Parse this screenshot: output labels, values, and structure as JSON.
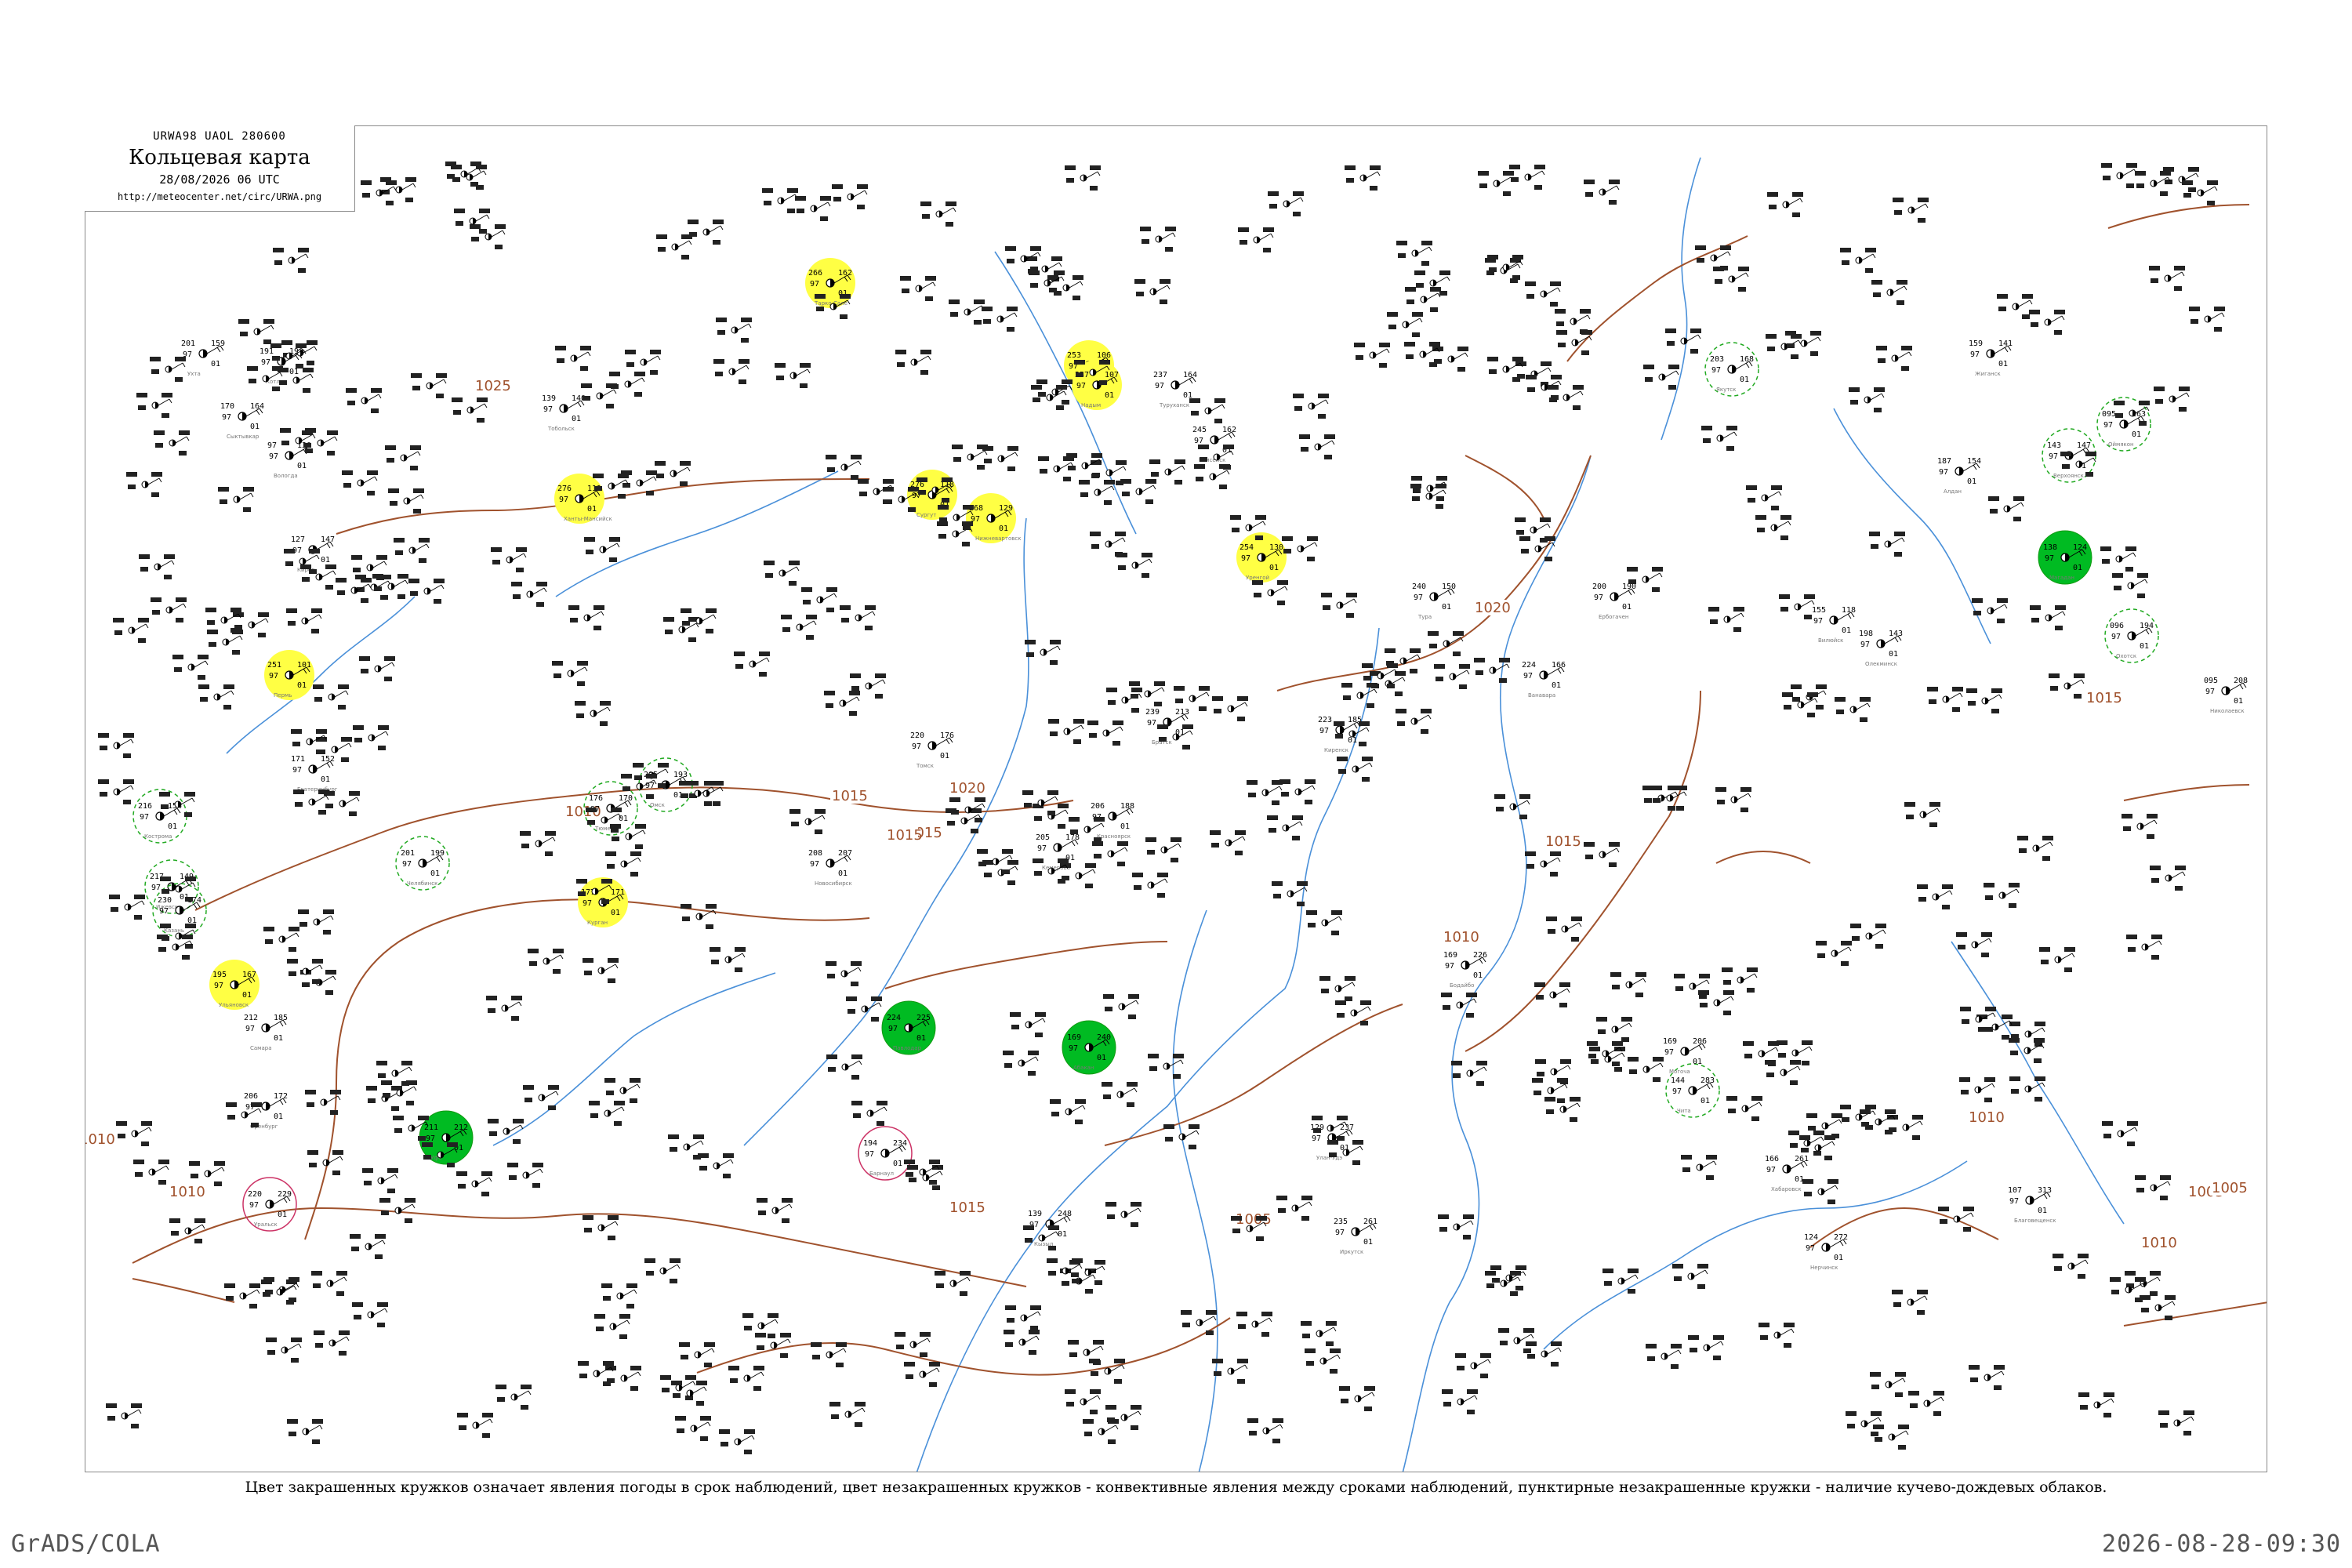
{
  "title_box": {
    "code": "URWA98  UAOL  280600",
    "title": "Кольцевая карта",
    "date": "28/08/2026 06 UTC",
    "url": "http://meteocenter.net/circ/URWA.png"
  },
  "caption": "Цвет закрашенных кружков означает явления погоды в срок наблюдений, цвет незакрашенных кружков - конвективные явления между сроками наблюдений, пунктирные незакрашенные кружки - наличие кучево-дождевых облаков.",
  "footer": {
    "left": "GrADS/COLA",
    "right": "2026-08-28-09:30"
  },
  "colors": {
    "isobar": "#a0522d",
    "river": "#4a90d9",
    "green_fill": "#00bb22",
    "yellow_fill": "#ffff44",
    "red_fill": "#ee2255",
    "green_dashed": "#22aa22",
    "red_ring": "#cc3366"
  },
  "isobar_labels": [
    "1010",
    "1015",
    "1020",
    "1025",
    "1015",
    "1015",
    "1020",
    "1015",
    "1010",
    "1015",
    "1005",
    "1010",
    "1005",
    "1010",
    "1005",
    "1010",
    "1015",
    "1010",
    "1005"
  ],
  "stations": [
    {
      "name": "Ухта",
      "p": "159",
      "t": "201",
      "fill": "none"
    },
    {
      "name": "Сыктывкар",
      "p": "164",
      "t": "170",
      "fill": "none"
    },
    {
      "name": "Котлас",
      "p": "190",
      "t": "191",
      "fill": "none"
    },
    {
      "name": "Вологда",
      "p": "130",
      "t": "97",
      "fill": "none"
    },
    {
      "name": "Киров",
      "p": "147",
      "t": "127",
      "fill": "none"
    },
    {
      "name": "Кострома",
      "p": "154",
      "t": "216",
      "fill": "dashed-green"
    },
    {
      "name": "Ижевск",
      "p": "149",
      "t": "217",
      "fill": "dashed-green"
    },
    {
      "name": "Казань",
      "p": "174",
      "t": "230",
      "fill": "dashed-green"
    },
    {
      "name": "Ульяновск",
      "p": "167",
      "t": "195",
      "fill": "yellow"
    },
    {
      "name": "Самара",
      "p": "185",
      "t": "212",
      "fill": "none"
    },
    {
      "name": "Оренбург",
      "p": "172",
      "t": "206",
      "fill": "none"
    },
    {
      "name": "Уральск",
      "p": "229",
      "t": "220",
      "fill": "red-ring"
    },
    {
      "name": "Пермь",
      "p": "101",
      "t": "251",
      "fill": "yellow"
    },
    {
      "name": "Екатеринбург",
      "p": "152",
      "t": "171",
      "fill": "none"
    },
    {
      "name": "Уфа",
      "p": "212",
      "t": "211",
      "fill": "green"
    },
    {
      "name": "Челябинск",
      "p": "199",
      "t": "201",
      "fill": "dashed-green"
    },
    {
      "name": "Курган",
      "p": "171",
      "t": "177",
      "fill": "yellow"
    },
    {
      "name": "Тюмень",
      "p": "170",
      "t": "176",
      "fill": "dashed-green"
    },
    {
      "name": "Тобольск",
      "p": "140",
      "t": "139",
      "fill": "none"
    },
    {
      "name": "Ханты-Мансийск",
      "p": "111",
      "t": "276",
      "fill": "yellow"
    },
    {
      "name": "Сургут",
      "p": "118",
      "t": "276",
      "fill": "yellow"
    },
    {
      "name": "Нижневартовск",
      "p": "129",
      "t": "268",
      "fill": "yellow"
    },
    {
      "name": "Омск",
      "p": "193",
      "t": "205",
      "fill": "dashed-green"
    },
    {
      "name": "Павлодар",
      "p": "225",
      "t": "224",
      "fill": "green"
    },
    {
      "name": "Новосибирск",
      "p": "207",
      "t": "208",
      "fill": "none"
    },
    {
      "name": "Барнаул",
      "p": "234",
      "t": "194",
      "fill": "red-ring"
    },
    {
      "name": "Кемерово",
      "p": "178",
      "t": "205",
      "fill": "none"
    },
    {
      "name": "Томск",
      "p": "176",
      "t": "220",
      "fill": "none"
    },
    {
      "name": "Красноярск",
      "p": "188",
      "t": "206",
      "fill": "none"
    },
    {
      "name": "Абакан",
      "p": "240",
      "t": "169",
      "fill": "green"
    },
    {
      "name": "Кызыл",
      "p": "248",
      "t": "139",
      "fill": "none"
    },
    {
      "name": "Иркутск",
      "p": "261",
      "t": "235",
      "fill": "none"
    },
    {
      "name": "Улан-Удэ",
      "p": "237",
      "t": "129",
      "fill": "none"
    },
    {
      "name": "Чита",
      "p": "283",
      "t": "144",
      "fill": "dashed-green"
    },
    {
      "name": "Братск",
      "p": "213",
      "t": "239",
      "fill": "none"
    },
    {
      "name": "Киренск",
      "p": "185",
      "t": "223",
      "fill": "none"
    },
    {
      "name": "Туруханск",
      "p": "164",
      "t": "237",
      "fill": "none"
    },
    {
      "name": "Енисейск",
      "p": "162",
      "t": "245",
      "fill": "none"
    },
    {
      "name": "Салехард",
      "p": "106",
      "t": "253",
      "fill": "yellow"
    },
    {
      "name": "Надым",
      "p": "107",
      "t": "257",
      "fill": "yellow"
    },
    {
      "name": "Уренгой",
      "p": "130",
      "t": "254",
      "fill": "yellow"
    },
    {
      "name": "Тарко-Сале",
      "p": "162",
      "t": "266",
      "fill": "yellow"
    },
    {
      "name": "Якутск",
      "p": "168",
      "t": "203",
      "fill": "dashed-green"
    },
    {
      "name": "Олекминск",
      "p": "143",
      "t": "198",
      "fill": "none"
    },
    {
      "name": "Алдан",
      "p": "154",
      "t": "187",
      "fill": "none"
    },
    {
      "name": "Благовещенск",
      "p": "313",
      "t": "107",
      "fill": "none"
    },
    {
      "name": "Хабаровск",
      "p": "261",
      "t": "166",
      "fill": "none"
    },
    {
      "name": "Магадан",
      "p": "124",
      "t": "138",
      "fill": "green"
    },
    {
      "name": "Охотск",
      "p": "194",
      "t": "096",
      "fill": "dashed-green"
    },
    {
      "name": "Николаевск",
      "p": "208",
      "t": "095",
      "fill": "none"
    },
    {
      "name": "Оймякон",
      "p": "163",
      "t": "095",
      "fill": "dashed-green"
    },
    {
      "name": "Верхоянск",
      "p": "147",
      "t": "143",
      "fill": "dashed-green"
    },
    {
      "name": "Жиганск",
      "p": "141",
      "t": "159",
      "fill": "none"
    },
    {
      "name": "Вилюйск",
      "p": "118",
      "t": "155",
      "fill": "none"
    },
    {
      "name": "Ербогачен",
      "p": "190",
      "t": "200",
      "fill": "none"
    },
    {
      "name": "Тура",
      "p": "150",
      "t": "240",
      "fill": "none"
    },
    {
      "name": "Ванавара",
      "p": "166",
      "t": "224",
      "fill": "none"
    },
    {
      "name": "Бодайбо",
      "p": "226",
      "t": "169",
      "fill": "none"
    },
    {
      "name": "Могоча",
      "p": "206",
      "t": "169",
      "fill": "none"
    },
    {
      "name": "Нерчинск",
      "p": "272",
      "t": "124",
      "fill": "none"
    }
  ]
}
